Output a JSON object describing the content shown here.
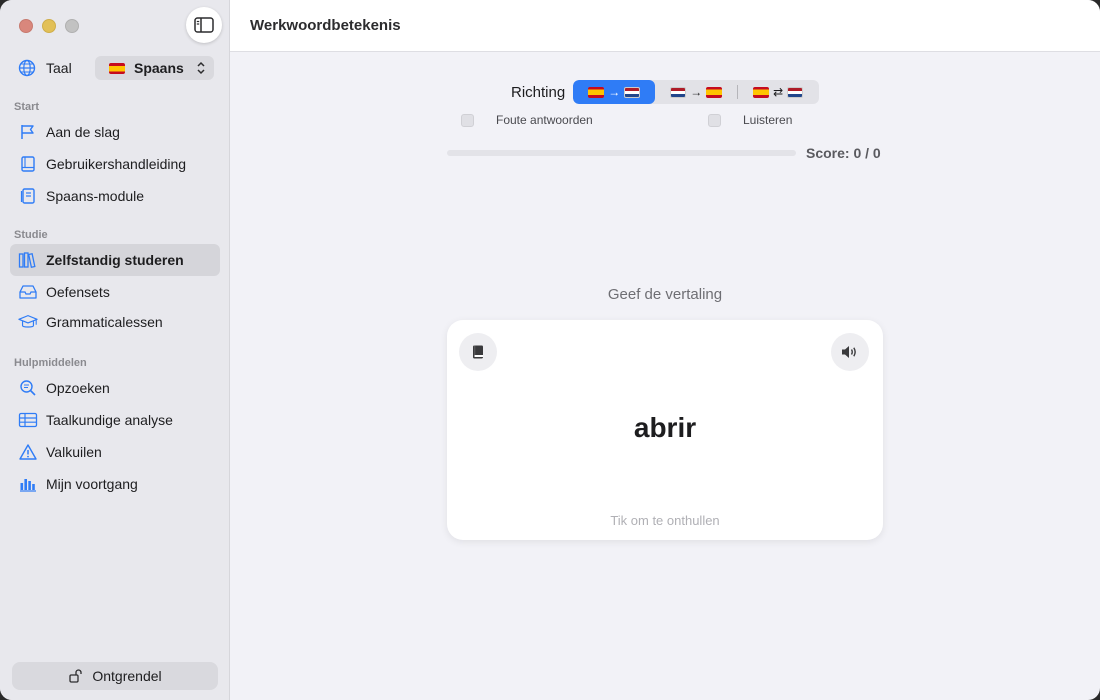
{
  "window": {
    "title": "Werkwoordbetekenis"
  },
  "sidebar": {
    "language": {
      "label": "Taal",
      "selected": "Spaans",
      "flag": "ES"
    },
    "sections": [
      {
        "title": "Start",
        "items": [
          {
            "label": "Aan de slag",
            "icon": "flag-icon"
          },
          {
            "label": "Gebruikershandleiding",
            "icon": "book-icon"
          },
          {
            "label": "Spaans-module",
            "icon": "module-icon"
          }
        ]
      },
      {
        "title": "Studie",
        "items": [
          {
            "label": "Zelfstandig studeren",
            "icon": "books-icon",
            "active": true
          },
          {
            "label": "Oefensets",
            "icon": "tray-icon"
          },
          {
            "label": "Grammaticalessen",
            "icon": "graduation-cap-icon"
          }
        ]
      },
      {
        "title": "Hulpmiddelen",
        "items": [
          {
            "label": "Opzoeken",
            "icon": "search-text-icon"
          },
          {
            "label": "Taalkundige analyse",
            "icon": "table-icon"
          },
          {
            "label": "Valkuilen",
            "icon": "warning-icon"
          },
          {
            "label": "Mijn voortgang",
            "icon": "bar-chart-icon"
          }
        ]
      }
    ],
    "unlock_label": "Ontgrendel"
  },
  "quiz": {
    "direction_label": "Richting",
    "direction_options": [
      {
        "from": "ES",
        "to": "NL",
        "arrow": "→",
        "selected": true
      },
      {
        "from": "NL",
        "to": "ES",
        "arrow": "→",
        "selected": false
      },
      {
        "from": "ES",
        "to": "NL",
        "arrow": "⇄",
        "selected": false
      }
    ],
    "options": {
      "wrong_answers": {
        "label": "Foute antwoorden",
        "checked": false
      },
      "listen": {
        "label": "Luisteren",
        "checked": false
      }
    },
    "progress": 0,
    "score_text": "Score: 0 / 0",
    "prompt": "Geef de vertaling",
    "word": "abrir",
    "hint": "Tik om te onthullen"
  },
  "colors": {
    "accent": "#2f7cf6",
    "sidebar_bg": "#e8e8ed",
    "main_bg": "#f2f2f7",
    "active_item_bg": "#d5d5da"
  }
}
